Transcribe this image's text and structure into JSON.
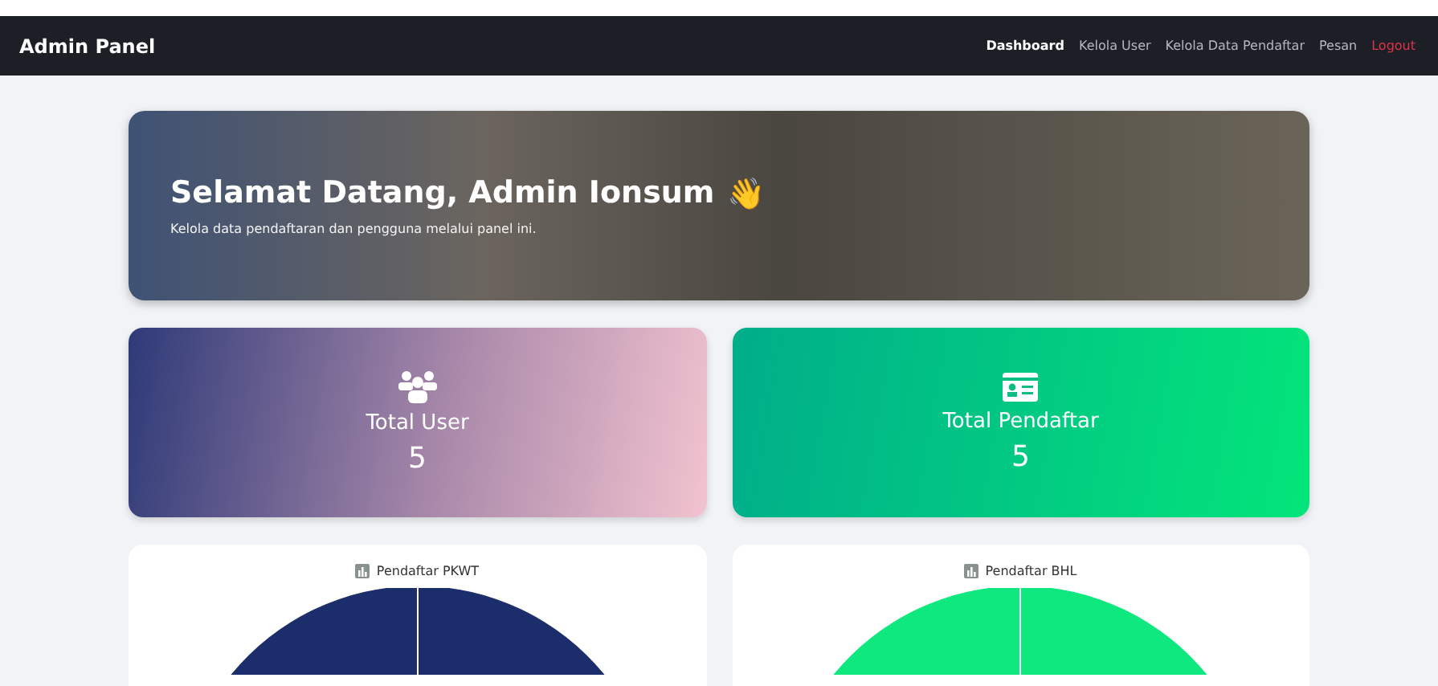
{
  "navbar": {
    "brand": "Admin Panel",
    "links": [
      {
        "label": "Dashboard",
        "selected": true,
        "kind": "link"
      },
      {
        "label": "Kelola User",
        "selected": false,
        "kind": "link"
      },
      {
        "label": "Kelola Data Pendaftar",
        "selected": false,
        "kind": "link"
      },
      {
        "label": "Pesan",
        "selected": false,
        "kind": "link"
      },
      {
        "label": "Logout",
        "selected": false,
        "kind": "logout"
      }
    ]
  },
  "hero": {
    "title": "Selamat Datang, Admin Ionsum",
    "emoji": "👋",
    "subtitle": "Kelola data pendaftaran dan pengguna melalui panel ini."
  },
  "stats": [
    {
      "kind": "users",
      "label": "Total User",
      "value": "5"
    },
    {
      "kind": "registrants",
      "label": "Total Pendaftar",
      "value": "5"
    }
  ],
  "charts": [
    {
      "title": "Pendaftar PKWT",
      "color": "#1b2d6b"
    },
    {
      "title": "Pendaftar BHL",
      "color": "#0ee87e"
    }
  ]
}
